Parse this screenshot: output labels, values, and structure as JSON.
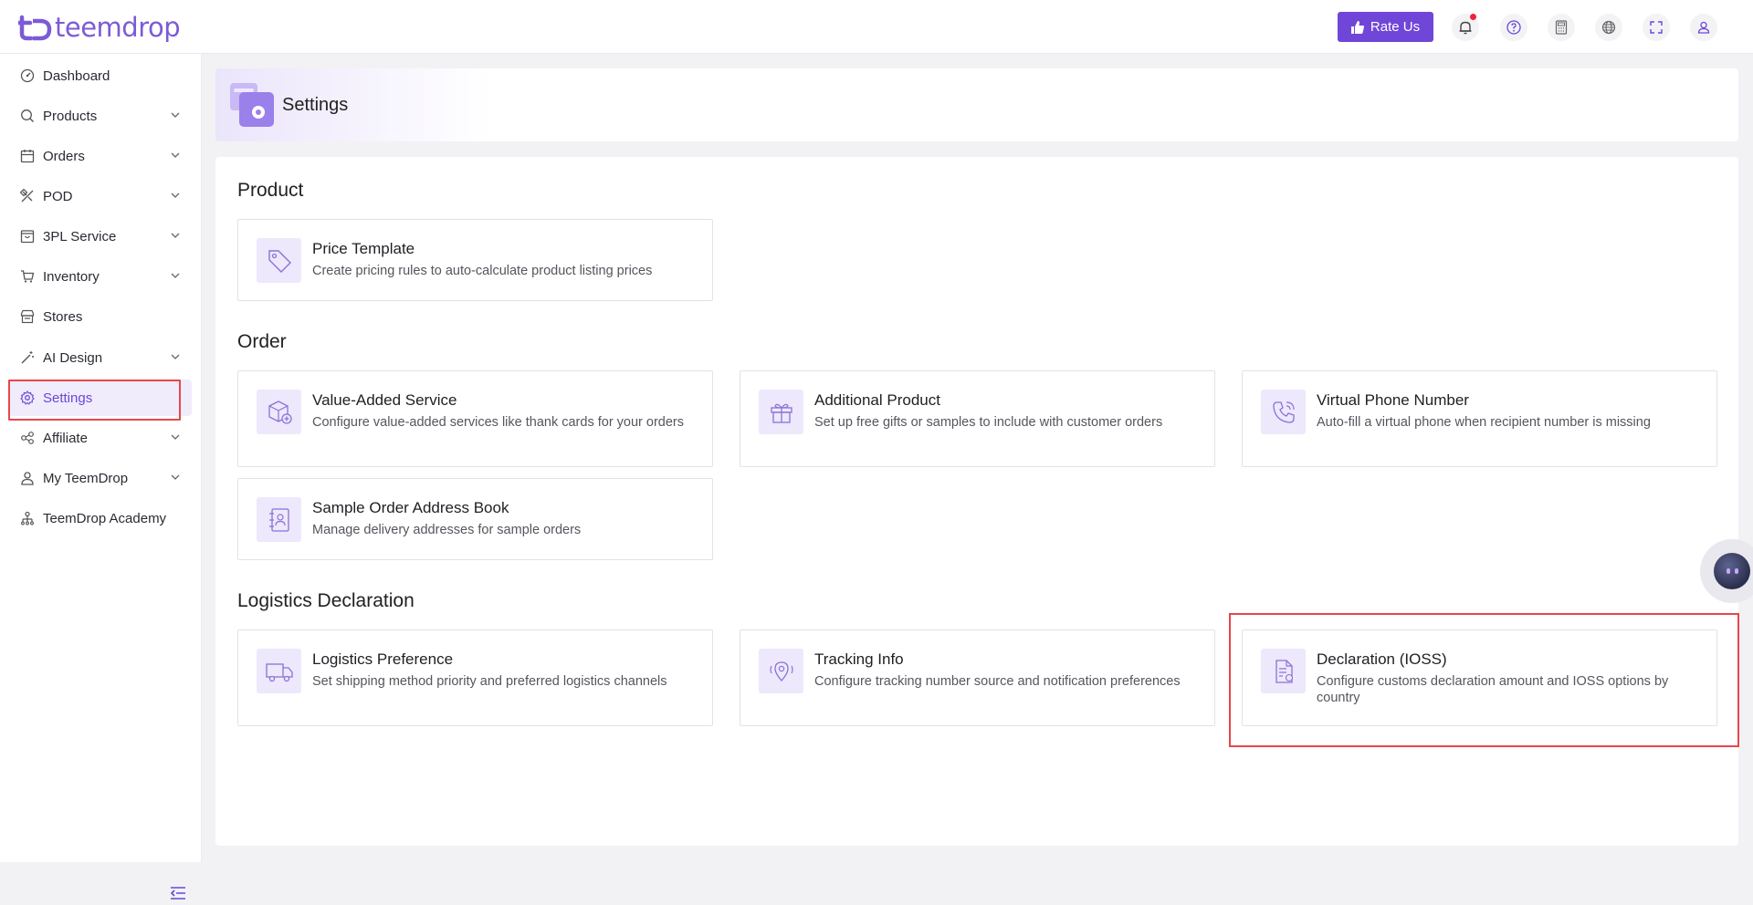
{
  "app": {
    "logo_text": "teemdrop",
    "rate_label": "Rate Us"
  },
  "sidebar": {
    "items": [
      {
        "label": "Dashboard",
        "icon": "dashboard-icon",
        "chevron": false
      },
      {
        "label": "Products",
        "icon": "search-icon",
        "chevron": true
      },
      {
        "label": "Orders",
        "icon": "calendar-icon",
        "chevron": true
      },
      {
        "label": "POD",
        "icon": "design-tools-icon",
        "chevron": true
      },
      {
        "label": "3PL Service",
        "icon": "warehouse-icon",
        "chevron": true
      },
      {
        "label": "Inventory",
        "icon": "cart-icon",
        "chevron": true
      },
      {
        "label": "Stores",
        "icon": "store-icon",
        "chevron": false
      },
      {
        "label": "AI Design",
        "icon": "magic-wand-icon",
        "chevron": true
      },
      {
        "label": "Settings",
        "icon": "gear-icon",
        "chevron": false,
        "active": true
      },
      {
        "label": "Affiliate",
        "icon": "share-icon",
        "chevron": true
      },
      {
        "label": "My TeemDrop",
        "icon": "user-icon",
        "chevron": true
      },
      {
        "label": "TeemDrop Academy",
        "icon": "academy-icon",
        "chevron": false
      }
    ]
  },
  "page": {
    "title": "Settings"
  },
  "sections": {
    "product": {
      "title": "Product",
      "cards": [
        {
          "title": "Price Template",
          "desc": "Create pricing rules to auto-calculate product listing prices",
          "icon": "price-tag-icon"
        }
      ]
    },
    "order": {
      "title": "Order",
      "cards": [
        {
          "title": "Value-Added Service",
          "desc": "Configure value-added services like thank cards for your orders",
          "icon": "package-plus-icon"
        },
        {
          "title": "Additional Product",
          "desc": "Set up free gifts or samples to include with customer orders",
          "icon": "gift-icon"
        },
        {
          "title": "Virtual Phone Number",
          "desc": "Auto-fill a virtual phone when recipient number is missing",
          "icon": "phone-icon"
        },
        {
          "title": "Sample Order Address Book",
          "desc": "Manage delivery addresses for sample orders",
          "icon": "address-book-icon"
        }
      ]
    },
    "logistics": {
      "title": "Logistics Declaration",
      "cards": [
        {
          "title": "Logistics Preference",
          "desc": "Set shipping method priority and preferred logistics channels",
          "icon": "truck-icon"
        },
        {
          "title": "Tracking Info",
          "desc": "Configure tracking number source and notification preferences",
          "icon": "location-pin-icon"
        },
        {
          "title": "Declaration (IOSS)",
          "desc": "Configure customs declaration amount and IOSS options by country",
          "icon": "document-icon"
        }
      ]
    }
  },
  "colors": {
    "accent": "#7046d9",
    "highlight_box": "#e8464c",
    "icon_bg": "#ede8fb"
  }
}
